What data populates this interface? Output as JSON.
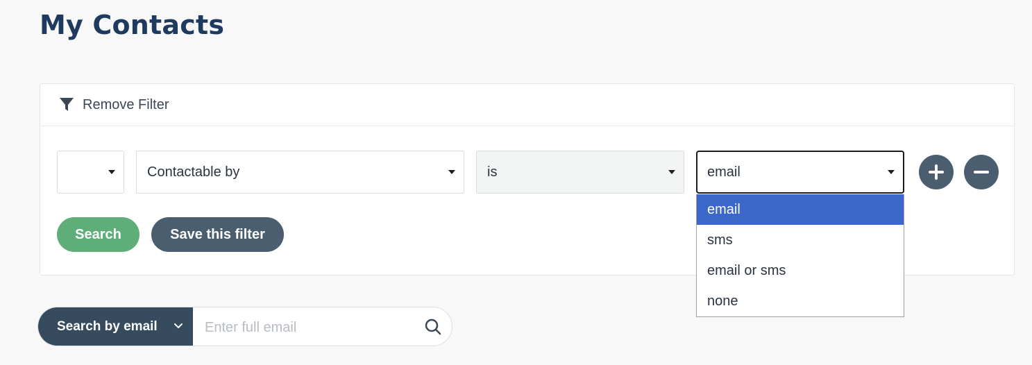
{
  "page": {
    "title": "My Contacts"
  },
  "filter_panel": {
    "header_label": "Remove Filter",
    "rule": {
      "prefix_value": "",
      "field_value": "Contactable by",
      "operator_value": "is",
      "value_value": "email"
    },
    "value_options": [
      {
        "label": "email",
        "selected": true
      },
      {
        "label": "sms",
        "selected": false
      },
      {
        "label": "email or sms",
        "selected": false
      },
      {
        "label": "none",
        "selected": false
      }
    ],
    "search_label": "Search",
    "save_label": "Save this filter"
  },
  "quick_search": {
    "type_label": "Search by email",
    "placeholder": "Enter full email",
    "value": ""
  },
  "colors": {
    "title": "#1e3a5f",
    "search_button": "#5fae79",
    "dark_button": "#4a5e70",
    "dropdown_selected": "#3a67c9"
  }
}
